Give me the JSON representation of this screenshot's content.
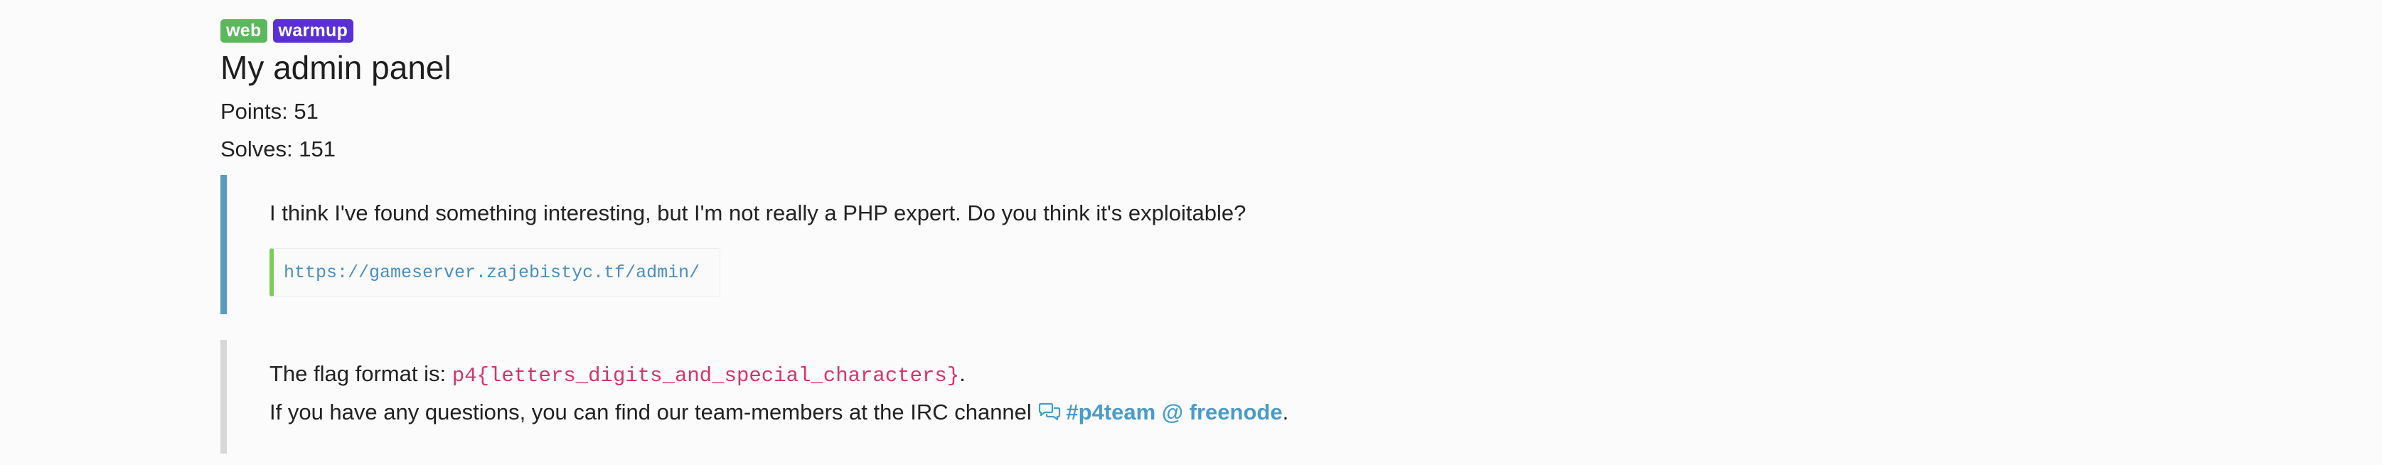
{
  "challenge": {
    "tags": [
      {
        "label": "web",
        "color": "#5cb85c"
      },
      {
        "label": "warmup",
        "color": "#5b2fd6"
      }
    ],
    "title": "My admin panel",
    "points_text": "Points: 51",
    "solves_text": "Solves: 151",
    "description": "I think I've found something interesting, but I'm not really a PHP expert. Do you think it's exploitable?",
    "url": "https://gameserver.zajebistyc.tf/admin/"
  },
  "footer": {
    "flag_prefix": "The flag format is: ",
    "flag_format": "p4{letters_digits_and_special_characters}",
    "flag_suffix": ".",
    "questions_prefix": "If you have any questions, you can find our team-members at the IRC channel ",
    "irc_icon": "chat-bubbles-icon",
    "irc_link": "#p4team @ freenode",
    "questions_suffix": "."
  },
  "colors": {
    "accent_link": "#4a9bc7",
    "code_pink": "#d6336c",
    "quote_border_blue": "#5a9bbf",
    "quote_border_gray": "#d8d8d8",
    "url_border_green": "#7ecb5a"
  }
}
